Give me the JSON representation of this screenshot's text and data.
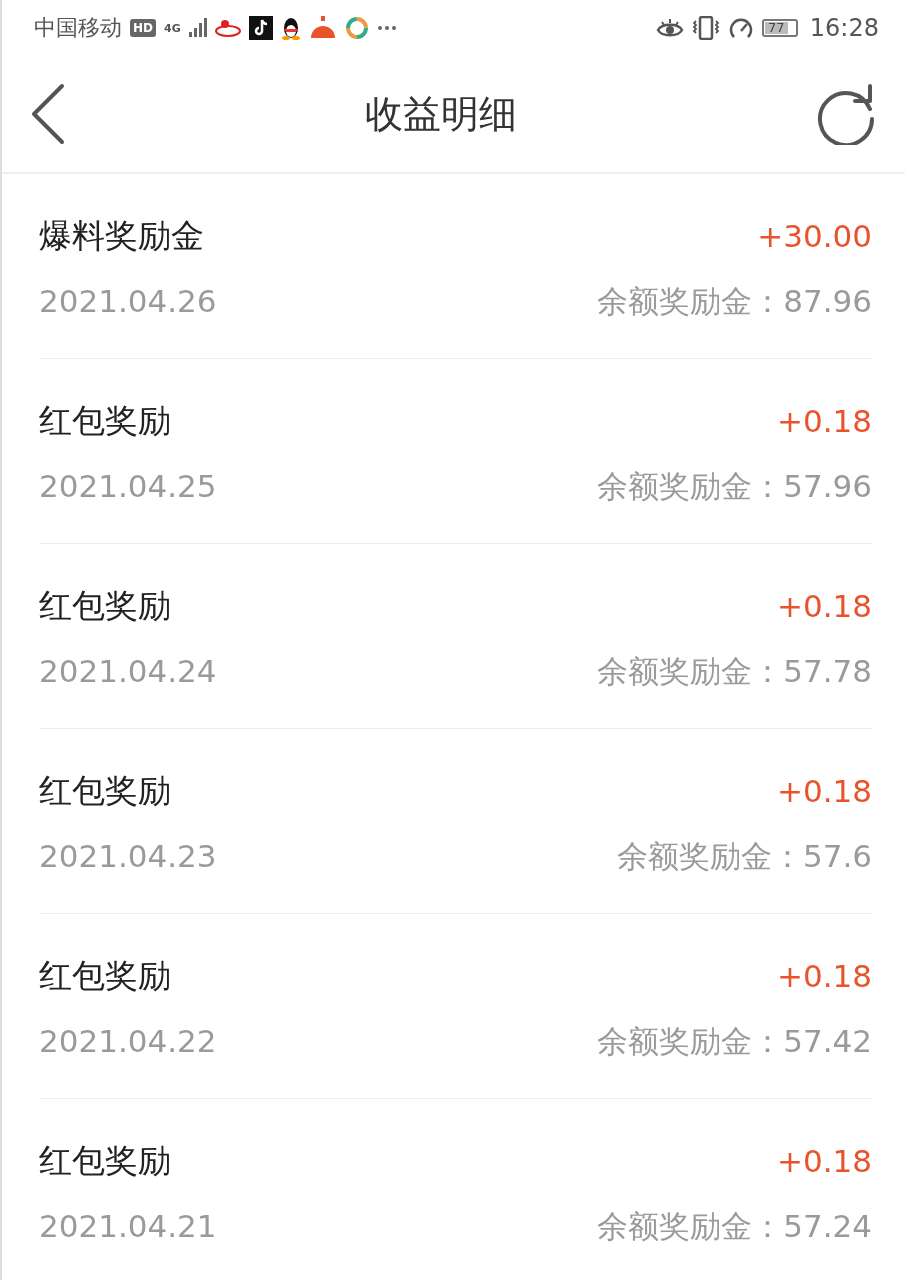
{
  "status_bar": {
    "carrier": "中国移动",
    "hd_badge": "HD",
    "network": "4G",
    "battery": "77",
    "time": "16:28"
  },
  "header": {
    "title": "收益明细"
  },
  "records": [
    {
      "title": "爆料奖励金",
      "amount": "+30.00",
      "date": "2021.04.26",
      "balance": "余额奖励金：87.96"
    },
    {
      "title": "红包奖励",
      "amount": "+0.18",
      "date": "2021.04.25",
      "balance": "余额奖励金：57.96"
    },
    {
      "title": "红包奖励",
      "amount": "+0.18",
      "date": "2021.04.24",
      "balance": "余额奖励金：57.78"
    },
    {
      "title": "红包奖励",
      "amount": "+0.18",
      "date": "2021.04.23",
      "balance": "余额奖励金：57.6"
    },
    {
      "title": "红包奖励",
      "amount": "+0.18",
      "date": "2021.04.22",
      "balance": "余额奖励金：57.42"
    },
    {
      "title": "红包奖励",
      "amount": "+0.18",
      "date": "2021.04.21",
      "balance": "余额奖励金：57.24"
    }
  ]
}
